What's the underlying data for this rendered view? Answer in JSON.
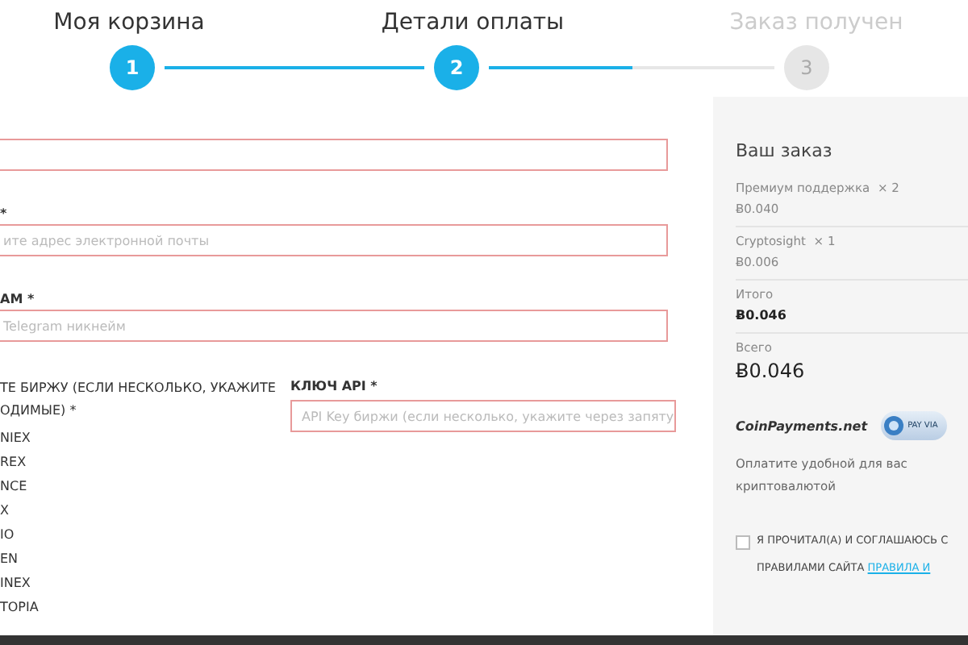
{
  "steps": [
    {
      "label": "Моя корзина",
      "number": "1",
      "done": true
    },
    {
      "label": "Детали оплаты",
      "number": "2",
      "done": true
    },
    {
      "label": "Заказ получен",
      "number": "3",
      "done": false
    }
  ],
  "connectors": [
    {
      "level": 1
    },
    {
      "level": 0.5
    }
  ],
  "form": {
    "fields": [
      {
        "invalid": true
      },
      {
        "label": "*",
        "placeholder": "ите адрес электронной почты",
        "invalid": true
      },
      {
        "label": "АМ *",
        "placeholder": "Telegram никнейм",
        "invalid": true
      }
    ],
    "exchanges": {
      "label": "ТЕ БИРЖУ (ЕСЛИ НЕСКОЛЬКО, УКАЖИТЕ ОДИМЫЕ) *",
      "options": [
        "NIEX",
        "REX",
        "NCE",
        "X",
        "IO",
        "EN",
        "INEX",
        "TOPIA"
      ]
    },
    "api_key": {
      "label": "КЛЮЧ API *",
      "placeholder": "API Key биржи (если несколько, укажите через запяту",
      "invalid": true
    }
  },
  "order": {
    "title": "Ваш заказ",
    "items": [
      {
        "name": "Премиум поддержка",
        "qty": "× 2",
        "price": "Ƀ0.040"
      },
      {
        "name": "Cryptosight",
        "qty": "× 1",
        "price": "Ƀ0.006"
      }
    ],
    "subtotal": {
      "label": "Итого",
      "value": "Ƀ0.046"
    },
    "total": {
      "label": "Всего",
      "value": "Ƀ0.046"
    },
    "payment": {
      "name": "CoinPayments.net",
      "badge": "PAY VIA",
      "description": "Оплатите удобной для вас криптовалютой"
    },
    "terms": {
      "checked": false,
      "text": "Я ПРОЧИТАЛ(А) И СОГЛАШАЮСЬ С ПРАВИЛАМИ САЙТА",
      "link": "ПРАВИЛА И"
    }
  }
}
